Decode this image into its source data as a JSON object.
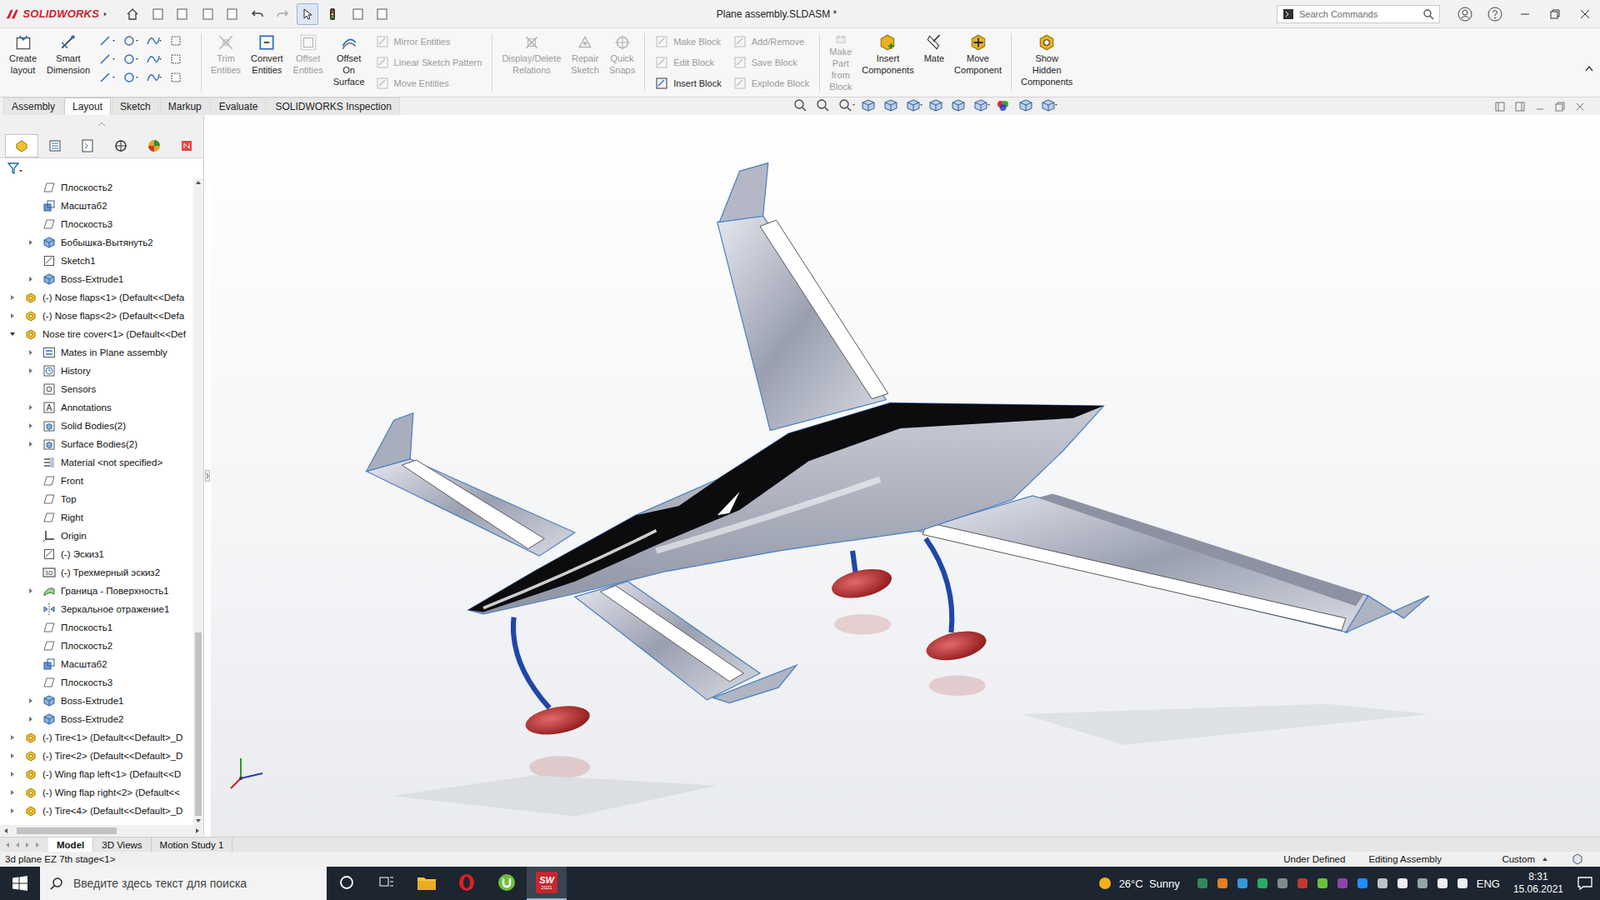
{
  "window": {
    "logo": "SOLIDWORKS",
    "title": "Plane assembly.SLDASM *"
  },
  "search": {
    "placeholder": "Search Commands"
  },
  "ribbon": [
    {
      "kind": "large",
      "lines": [
        "Create",
        "layout"
      ],
      "disabled": false
    },
    {
      "kind": "large",
      "lines": [
        "Smart",
        "Dimension"
      ],
      "disabled": false
    },
    {
      "kind": "sketch-tools"
    },
    {
      "kind": "separator"
    },
    {
      "kind": "large",
      "lines": [
        "Trim",
        "Entities"
      ],
      "disabled": true
    },
    {
      "kind": "large",
      "lines": [
        "Convert",
        "Entities"
      ],
      "disabled": false
    },
    {
      "kind": "large",
      "lines": [
        "Offset",
        "Entities"
      ],
      "disabled": true
    },
    {
      "kind": "large",
      "lines": [
        "Offset",
        "On",
        "Surface"
      ],
      "disabled": false
    },
    {
      "kind": "column",
      "items": [
        {
          "label": "Mirror Entities",
          "disabled": true
        },
        {
          "label": "Linear Sketch Pattern",
          "disabled": true
        },
        {
          "label": "Move Entities",
          "disabled": true
        }
      ]
    },
    {
      "kind": "separator"
    },
    {
      "kind": "large",
      "lines": [
        "Display/Delete",
        "Relations"
      ],
      "disabled": true
    },
    {
      "kind": "large",
      "lines": [
        "Repair",
        "Sketch"
      ],
      "disabled": true
    },
    {
      "kind": "large",
      "lines": [
        "Quick",
        "Snaps"
      ],
      "disabled": true
    },
    {
      "kind": "separator"
    },
    {
      "kind": "column",
      "items": [
        {
          "label": "Make Block",
          "disabled": true
        },
        {
          "label": "Edit Block",
          "disabled": true
        },
        {
          "label": "Insert Block",
          "disabled": false
        }
      ]
    },
    {
      "kind": "column",
      "items": [
        {
          "label": "Add/Remove",
          "disabled": true
        },
        {
          "label": "Save Block",
          "disabled": true
        },
        {
          "label": "Explode Block",
          "disabled": true
        }
      ]
    },
    {
      "kind": "separator"
    },
    {
      "kind": "large",
      "lines": [
        "Make",
        "Part",
        "from",
        "Block"
      ],
      "disabled": true
    },
    {
      "kind": "large",
      "lines": [
        "Insert",
        "Components"
      ],
      "disabled": false
    },
    {
      "kind": "large",
      "lines": [
        "Mate"
      ],
      "disabled": false
    },
    {
      "kind": "large",
      "lines": [
        "Move",
        "Component"
      ],
      "disabled": false
    },
    {
      "kind": "separator"
    },
    {
      "kind": "large",
      "lines": [
        "Show",
        "Hidden",
        "Components"
      ],
      "disabled": false
    }
  ],
  "tabs": [
    {
      "label": "Assembly",
      "selected": false
    },
    {
      "label": "Layout",
      "selected": true
    },
    {
      "label": "Sketch",
      "selected": false
    },
    {
      "label": "Markup",
      "selected": false
    },
    {
      "label": "Evaluate",
      "selected": false
    },
    {
      "label": "SOLIDWORKS Inspection",
      "selected": false
    }
  ],
  "tree": [
    {
      "label": "Плоскость2",
      "level": 1,
      "icon": "plane",
      "expandable": false,
      "expanded": false
    },
    {
      "label": "Масштаб2",
      "level": 1,
      "icon": "scale",
      "expandable": false,
      "expanded": false
    },
    {
      "label": "Плоскость3",
      "level": 1,
      "icon": "plane",
      "expandable": false,
      "expanded": false
    },
    {
      "label": "Бобышка-Вытянуть2",
      "level": 1,
      "icon": "feature",
      "expandable": true,
      "expanded": false
    },
    {
      "label": "Sketch1",
      "level": 1,
      "icon": "sketch",
      "expandable": false,
      "expanded": false
    },
    {
      "label": "Boss-Extrude1",
      "level": 1,
      "icon": "feature",
      "expandable": true,
      "expanded": false
    },
    {
      "label": "(-) Nose flaps<1> (Default<<Defa",
      "level": 0,
      "icon": "part",
      "expandable": true,
      "expanded": false
    },
    {
      "label": "(-) Nose flaps<2> (Default<<Defa",
      "level": 0,
      "icon": "part",
      "expandable": true,
      "expanded": false
    },
    {
      "label": "Nose tire cover<1> (Default<<Def",
      "level": 0,
      "icon": "part",
      "expandable": true,
      "expanded": true
    },
    {
      "label": "Mates in Plane assembly",
      "level": 1,
      "icon": "mates",
      "expandable": true,
      "expanded": false
    },
    {
      "label": "History",
      "level": 1,
      "icon": "history",
      "expandable": true,
      "expanded": false
    },
    {
      "label": "Sensors",
      "level": 1,
      "icon": "sensor",
      "expandable": false,
      "expanded": false
    },
    {
      "label": "Annotations",
      "level": 1,
      "icon": "annotation",
      "expandable": true,
      "expanded": false
    },
    {
      "label": "Solid Bodies(2)",
      "level": 1,
      "icon": "bodies",
      "expandable": true,
      "expanded": false
    },
    {
      "label": "Surface Bodies(2)",
      "level": 1,
      "icon": "bodies",
      "expandable": true,
      "expanded": false
    },
    {
      "label": "Material <not specified>",
      "level": 1,
      "icon": "material",
      "expandable": false,
      "expanded": false
    },
    {
      "label": "Front",
      "level": 1,
      "icon": "plane",
      "expandable": false,
      "expanded": false
    },
    {
      "label": "Top",
      "level": 1,
      "icon": "plane",
      "expandable": false,
      "expanded": false
    },
    {
      "label": "Right",
      "level": 1,
      "icon": "plane",
      "expandable": false,
      "expanded": false
    },
    {
      "label": "Origin",
      "level": 1,
      "icon": "origin",
      "expandable": false,
      "expanded": false
    },
    {
      "label": "(-) Эскиз1",
      "level": 1,
      "icon": "sketch",
      "expandable": false,
      "expanded": false
    },
    {
      "label": "(-) Трехмерный эскиз2",
      "level": 1,
      "icon": "sketch3d",
      "expandable": false,
      "expanded": false
    },
    {
      "label": "Граница - Поверхность1",
      "level": 1,
      "icon": "surface",
      "expandable": true,
      "expanded": false
    },
    {
      "label": "Зеркальное отражение1",
      "level": 1,
      "icon": "mirror",
      "expandable": false,
      "expanded": false
    },
    {
      "label": "Плоскость1",
      "level": 1,
      "icon": "plane",
      "expandable": false,
      "expanded": false
    },
    {
      "label": "Плоскость2",
      "level": 1,
      "icon": "plane",
      "expandable": false,
      "expanded": false
    },
    {
      "label": "Масштаб2",
      "level": 1,
      "icon": "scale",
      "expandable": false,
      "expanded": false
    },
    {
      "label": "Плоскость3",
      "level": 1,
      "icon": "plane",
      "expandable": false,
      "expanded": false
    },
    {
      "label": "Boss-Extrude1",
      "level": 1,
      "icon": "feature",
      "expandable": true,
      "expanded": false
    },
    {
      "label": "Boss-Extrude2",
      "level": 1,
      "icon": "feature",
      "expandable": true,
      "expanded": false
    },
    {
      "label": "(-) Tire<1> (Default<<Default>_D",
      "level": 0,
      "icon": "part",
      "expandable": true,
      "expanded": false
    },
    {
      "label": "(-) Tire<2> (Default<<Default>_D",
      "level": 0,
      "icon": "part",
      "expandable": true,
      "expanded": false
    },
    {
      "label": "(-) Wing flap left<1> (Default<<D",
      "level": 0,
      "icon": "part",
      "expandable": true,
      "expanded": false
    },
    {
      "label": "(-) Wing flap right<2> (Default<<",
      "level": 0,
      "icon": "part",
      "expandable": true,
      "expanded": false
    },
    {
      "label": "(-) Tire<4> (Default<<Default>_D",
      "level": 0,
      "icon": "part",
      "expandable": true,
      "expanded": false
    }
  ],
  "bottom_tabs": [
    {
      "label": "Model",
      "selected": true
    },
    {
      "label": "3D Views",
      "selected": false
    },
    {
      "label": "Motion Study 1",
      "selected": false
    }
  ],
  "status_bar": {
    "selection": "3d plane EZ 7th stage<1>",
    "state": "Under Defined",
    "mode": "Editing Assembly",
    "units": "Custom"
  },
  "taskbar": {
    "search_placeholder": "Введите здесь текст для поиска",
    "apps": [
      {
        "kind": "explorer",
        "label": "",
        "badge": "",
        "active": false
      },
      {
        "kind": "opera",
        "label": "",
        "badge": "",
        "active": false
      },
      {
        "kind": "utorrent",
        "label": "",
        "badge": "",
        "active": false
      },
      {
        "kind": "solidworks",
        "label": "SW",
        "badge": "2021",
        "active": true
      }
    ],
    "weather": "26°C  Sunny",
    "lang": "ENG",
    "time": "8:31",
    "date": "15.06.2021"
  }
}
